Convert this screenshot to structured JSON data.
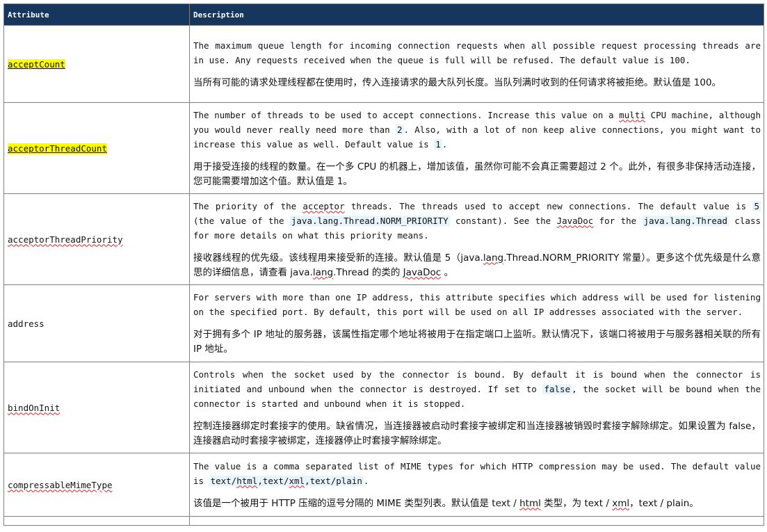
{
  "table": {
    "header": {
      "attribute": "Attribute",
      "description": "Description"
    },
    "rows": [
      {
        "name": "acceptCount",
        "en": [
          "The maximum queue length for incoming connection requests when all possible request processing threads are in use. Any requests received when the queue is full will be refused. The default value is 100."
        ],
        "zh": [
          "当所有可能的请求处理线程都在使用时，传入连接请求的最大队列长度。当队列满时收到的任何请求将被拒绝。默认值是 100。"
        ]
      },
      {
        "name": "acceptorThreadCount",
        "en": [
          "The number of threads to be used to accept connections. Increase this value on a ",
          "multi",
          " CPU machine, although you would never really need more than ",
          "2",
          ". Also, with a lot of non keep alive connections, you might want to increase this value as well. Default value is ",
          "1",
          "."
        ],
        "zh": [
          "用于接受连接的线程的数量。在一个多 CPU 的机器上，增加该值，虽然你可能不会真正需要超过 2 个。此外，有很多非保持活动连接，您可能需要增加这个值。默认值是 1。"
        ]
      },
      {
        "name": "acceptorThreadPriority",
        "en": [
          "The priority of the ",
          "acceptor",
          " threads. The threads used to accept new connections. The default value is ",
          "5",
          " (the value of the ",
          "java.lang.Thread.NORM_PRIORITY",
          " constant). See the ",
          "JavaDoc",
          " for the ",
          "java.lang.Thread",
          " class for more details on what this priority means."
        ],
        "zh": [
          "接收器线程的优先级。该线程用来接受新的连接。默认值是 5（java.",
          "lang",
          ".Thread.NORM_PRIORITY 常量）。更多这个优先级是什么意思的详细信息，请查看 java.",
          "lang",
          ".Thread 的类的 ",
          "JavaDoc",
          " 。"
        ]
      },
      {
        "name": "address",
        "en": [
          "For servers with more than one IP address, this attribute specifies which address will be used for listening on the specified port. By default, this port will be used on all IP addresses associated with the server."
        ],
        "zh": [
          "对于拥有多个 IP 地址的服务器，该属性指定哪个地址将被用于在指定端口上监听。默认情况下，该端口将被用于与服务器相关联的所有 IP 地址。"
        ]
      },
      {
        "name": "bindOnInit",
        "en": [
          "Controls when the socket used by the connector is bound. By default it is bound when the connector is initiated and unbound when the connector is destroyed. If set to ",
          "false",
          ", the socket will be bound when the connector is started and unbound when it is stopped."
        ],
        "zh": [
          "控制连接器绑定时套接字的使用。缺省情况，当连接器被启动时套接字被绑定和当连接器被销毁时套接字解除绑定。如果设置为 false，连接器启动时套接字被绑定，连接器停止时套接字解除绑定。"
        ]
      },
      {
        "name": "compressableMimeType",
        "en": [
          "The value is a comma separated list of MIME types for which HTTP compression may be used. The default value is ",
          "text/",
          "html",
          ",text/",
          "xml",
          ",text/plain",
          "."
        ],
        "zh": [
          "该值是一个被用于 HTTP 压缩的逗号分隔的 MIME 类型列表。默认值是 text / ",
          "html",
          " 类型，为 text / ",
          "xml",
          "，text / plain。"
        ]
      }
    ]
  }
}
